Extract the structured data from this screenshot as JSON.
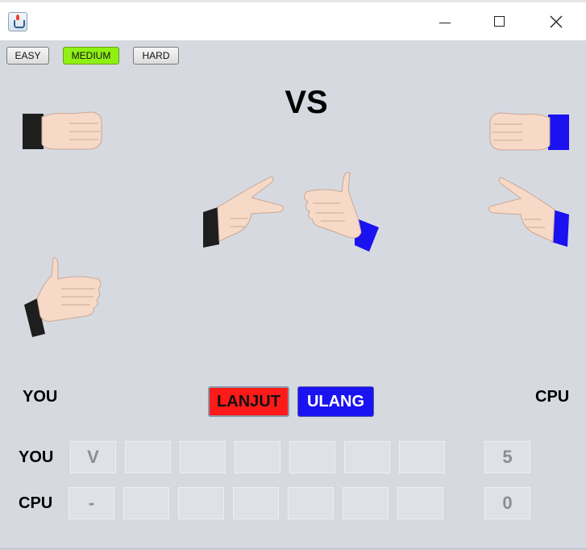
{
  "window": {
    "title": "",
    "controls": [
      "minimize",
      "maximize",
      "close"
    ]
  },
  "difficulty": {
    "buttons": [
      {
        "label": "EASY",
        "active": false
      },
      {
        "label": "MEDIUM",
        "active": true
      },
      {
        "label": "HARD",
        "active": false
      }
    ],
    "active_color": "#8ff014"
  },
  "arena": {
    "vs_label": "VS",
    "player_choices": [
      "rock",
      "scissors",
      "paper"
    ],
    "cpu_choices": [
      "rock",
      "scissors"
    ],
    "player_selected": "scissors",
    "cpu_selected": "paper",
    "player_sleeve_color": "#1e1e1e",
    "cpu_sleeve_color": "#1a12f0"
  },
  "labels": {
    "you": "YOU",
    "cpu": "CPU"
  },
  "actions": {
    "lanjut": "LANJUT",
    "ulang": "ULANG",
    "lanjut_color": "#ff1a1a",
    "ulang_color": "#1a12f0"
  },
  "scoreboard": {
    "you_label": "YOU",
    "cpu_label": "CPU",
    "you_rounds": [
      "V",
      "",
      "",
      "",
      "",
      "",
      ""
    ],
    "cpu_rounds": [
      "-",
      "",
      "",
      "",
      "",
      "",
      ""
    ],
    "you_total": "5",
    "cpu_total": "0"
  }
}
